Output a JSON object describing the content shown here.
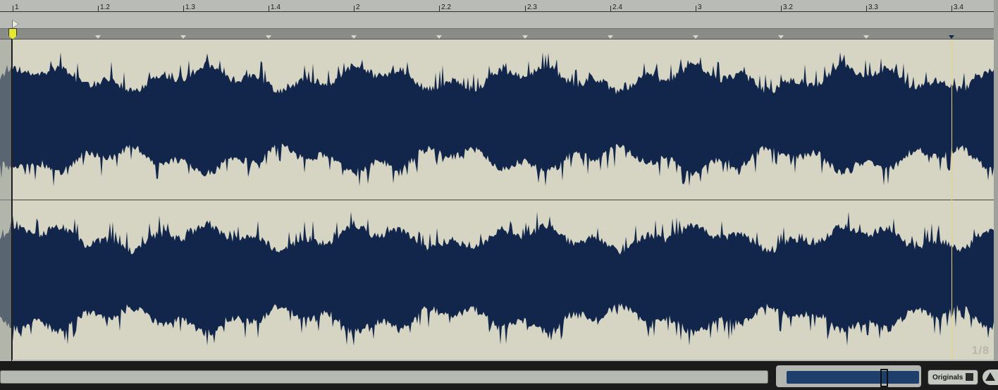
{
  "ruler": {
    "labels": [
      "1",
      "1.2",
      "1.3",
      "1.4",
      "2",
      "2.2",
      "2.3",
      "2.4",
      "3",
      "3.2",
      "3.3",
      "3.4"
    ]
  },
  "overview": {
    "loop_fraction": "1/8"
  },
  "bottom": {
    "originals_label": "Originals"
  },
  "colors": {
    "waveform": "#11264a",
    "background": "#d6d5c3",
    "start_marker": "#e6e82b"
  },
  "icons": {
    "play": "play-triangle-icon",
    "start": "start-marker-icon",
    "up": "up-arrow-icon"
  }
}
